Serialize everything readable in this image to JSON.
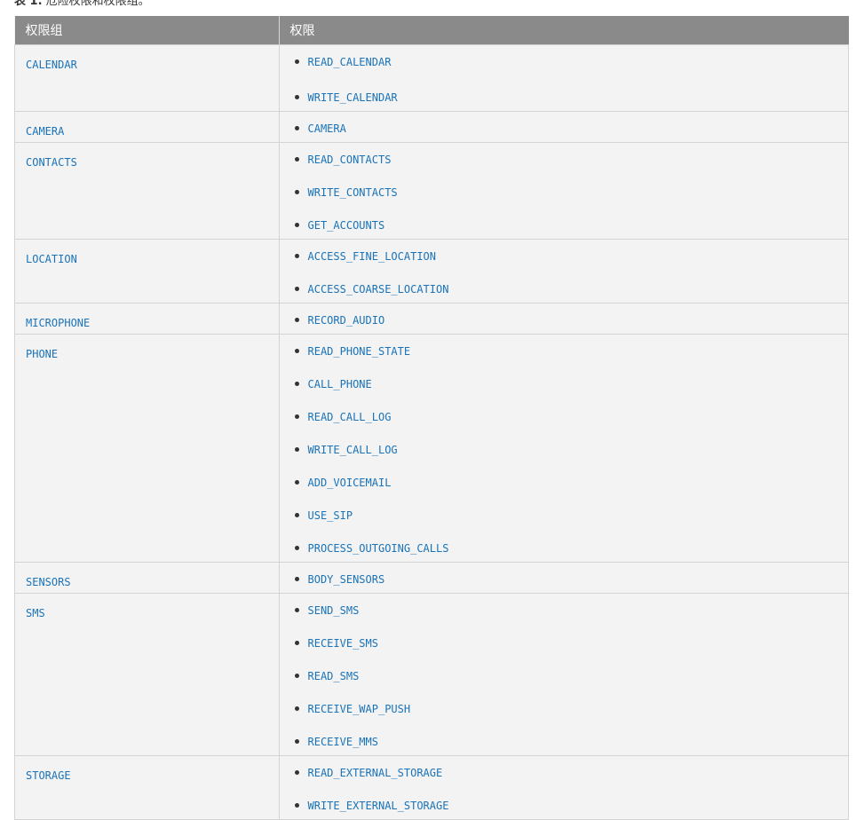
{
  "caption": {
    "label": "表 1.",
    "text": " 危险权限和权限组。"
  },
  "table": {
    "headers": [
      "权限组",
      "权限"
    ],
    "rows": [
      {
        "group": "CALENDAR",
        "permissions": [
          "READ_CALENDAR",
          "WRITE_CALENDAR"
        ]
      },
      {
        "group": "CAMERA",
        "permissions": [
          "CAMERA"
        ]
      },
      {
        "group": "CONTACTS",
        "permissions": [
          "READ_CONTACTS",
          "WRITE_CONTACTS",
          "GET_ACCOUNTS"
        ]
      },
      {
        "group": "LOCATION",
        "permissions": [
          "ACCESS_FINE_LOCATION",
          "ACCESS_COARSE_LOCATION"
        ]
      },
      {
        "group": "MICROPHONE",
        "permissions": [
          "RECORD_AUDIO"
        ]
      },
      {
        "group": "PHONE",
        "permissions": [
          "READ_PHONE_STATE",
          "CALL_PHONE",
          "READ_CALL_LOG",
          "WRITE_CALL_LOG",
          "ADD_VOICEMAIL",
          "USE_SIP",
          "PROCESS_OUTGOING_CALLS"
        ]
      },
      {
        "group": "SENSORS",
        "permissions": [
          "BODY_SENSORS"
        ]
      },
      {
        "group": "SMS",
        "permissions": [
          "SEND_SMS",
          "RECEIVE_SMS",
          "READ_SMS",
          "RECEIVE_WAP_PUSH",
          "RECEIVE_MMS"
        ]
      },
      {
        "group": "STORAGE",
        "permissions": [
          "READ_EXTERNAL_STORAGE",
          "WRITE_EXTERNAL_STORAGE"
        ]
      }
    ]
  },
  "colors": {
    "header_bg": "#8a8a8a",
    "row_bg": "#f3f3f3",
    "link": "#1a73b8"
  }
}
